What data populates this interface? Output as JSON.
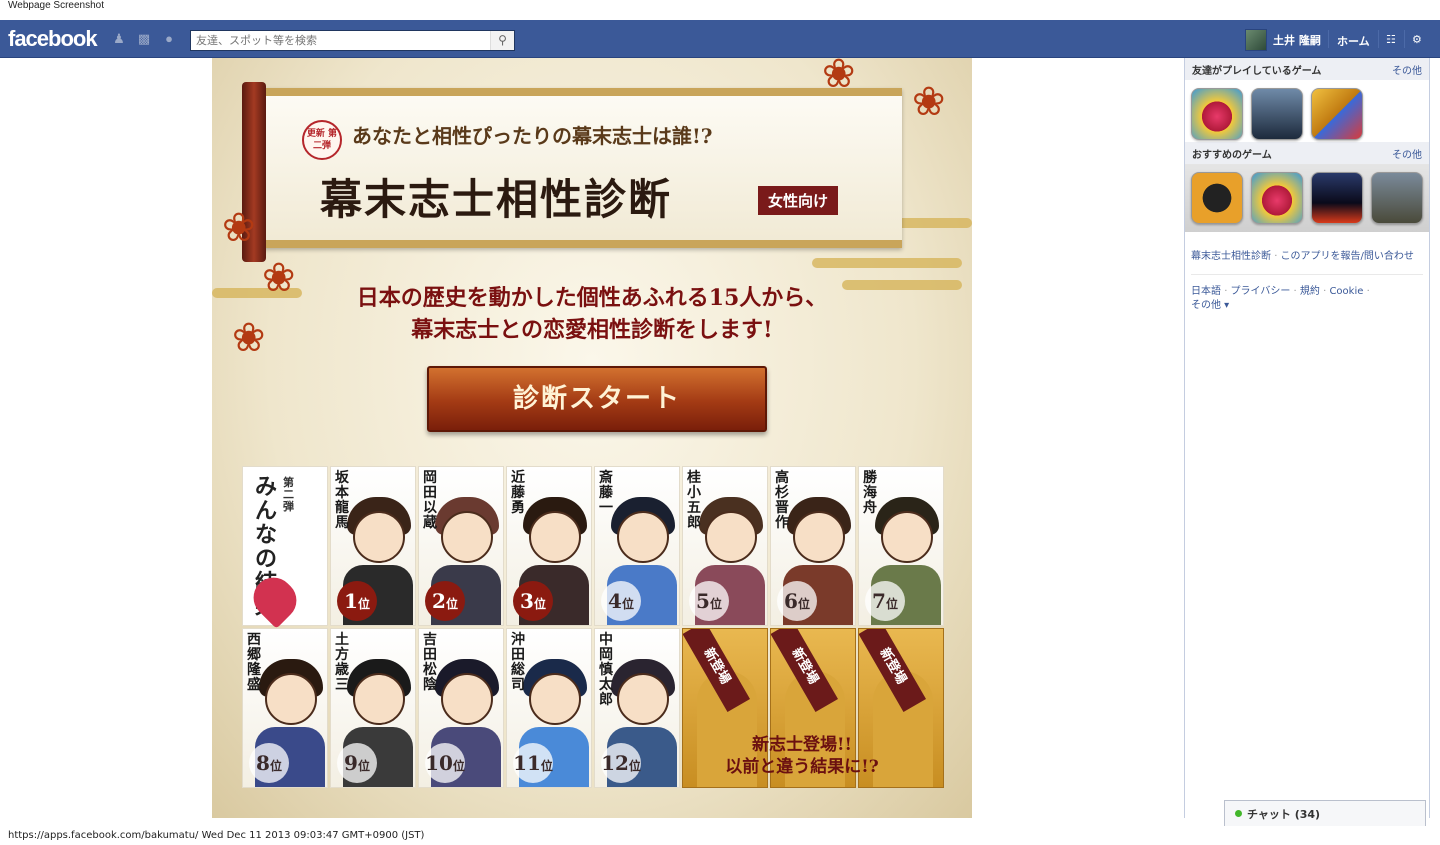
{
  "window_title": "Webpage Screenshot",
  "topbar": {
    "logo": "facebook",
    "search_placeholder": "友達、スポット等を検索",
    "user_name": "土井 隆嗣",
    "home": "ホーム"
  },
  "app": {
    "update_badge": "更新 第二弾",
    "catch": "あなたと相性ぴったりの幕末志士は誰!?",
    "title": "幕末志士相性診断",
    "women_tag": "女性向け",
    "desc_line1": "日本の歴史を動かした個性あふれる15人から、",
    "desc_line2": "幕末志士との恋愛相性診断をします!",
    "start_button": "診断スタート",
    "minna": {
      "sub": "第二弾",
      "main": "みんなの結果"
    },
    "new_char_msg1": "新志士登場!!",
    "new_char_msg2": "以前と違う結果に!?",
    "new_ribbon": "新登場",
    "rank_suffix": "位",
    "row1": [
      {
        "name": "坂本龍馬",
        "rank": "1"
      },
      {
        "name": "岡田以蔵",
        "rank": "2"
      },
      {
        "name": "近藤勇",
        "rank": "3"
      },
      {
        "name": "斎藤一",
        "rank": "4"
      },
      {
        "name": "桂小五郎",
        "rank": "5"
      },
      {
        "name": "高杉晋作",
        "rank": "6"
      },
      {
        "name": "勝海舟",
        "rank": "7"
      }
    ],
    "row2": [
      {
        "name": "西郷隆盛",
        "rank": "8"
      },
      {
        "name": "土方歳三",
        "rank": "9"
      },
      {
        "name": "吉田松陰",
        "rank": "10"
      },
      {
        "name": "沖田総司",
        "rank": "11"
      },
      {
        "name": "中岡慎太郎",
        "rank": "12"
      }
    ]
  },
  "sidebar": {
    "friends_games": "友達がプレイしているゲーム",
    "recommended_games": "おすすめのゲーム",
    "more": "その他",
    "app_link": "幕末志士相性診断",
    "report": "このアプリを報告/問い合わせ",
    "lang": "日本語",
    "privacy": "プライバシー",
    "terms": "規約",
    "cookie": "Cookie",
    "other": "その他"
  },
  "chat": {
    "label": "チャット (34)"
  },
  "footer": "https://apps.facebook.com/bakumatu/ Wed Dec 11 2013 09:03:47 GMT+0900 (JST)"
}
